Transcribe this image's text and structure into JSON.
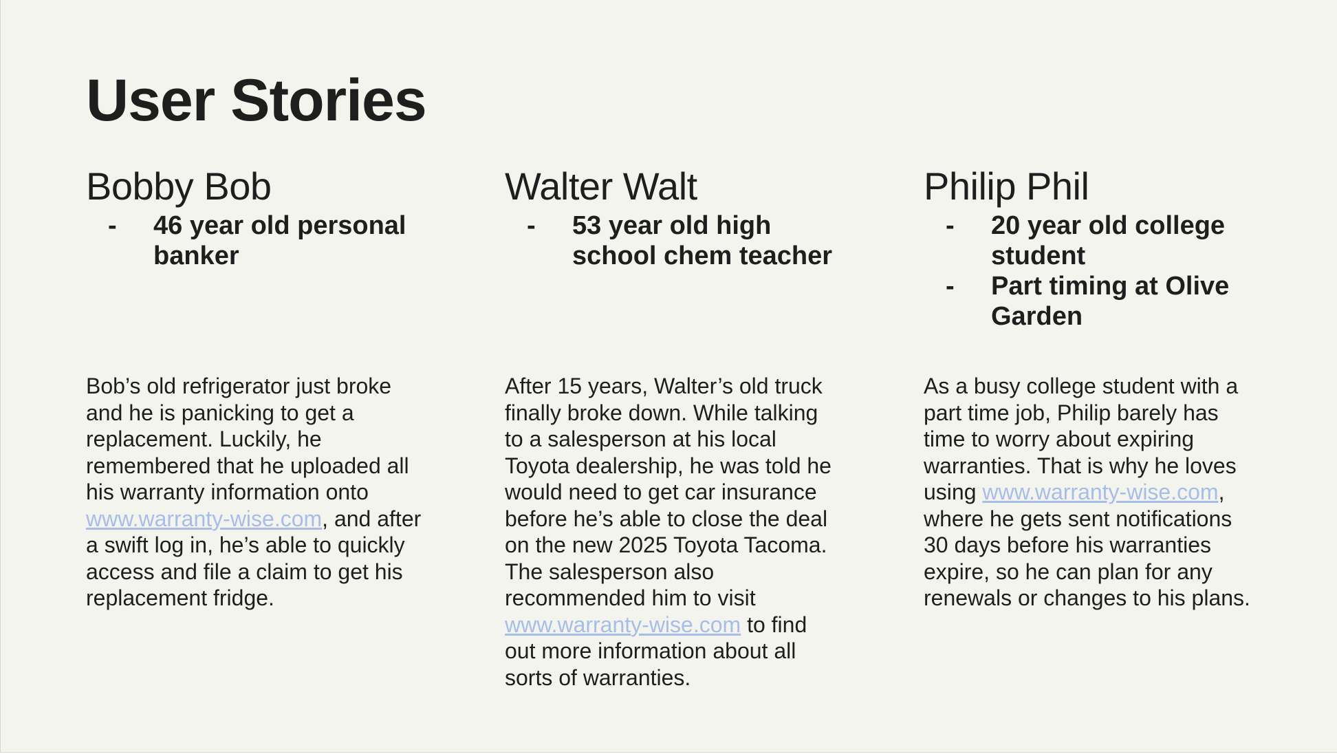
{
  "title": "User Stories",
  "personas": [
    {
      "name": "Bobby Bob",
      "traits": [
        "46 year old personal banker"
      ],
      "story": {
        "before": "Bob’s old refrigerator just broke and he is panicking to get a replacement. Luckily, he remembered that he uploaded all his warranty information onto ",
        "link": "www.warranty-wise.com",
        "after": ", and after a swift log in, he’s able to quickly access and file a claim to get his replacement fridge."
      }
    },
    {
      "name": "Walter Walt",
      "traits": [
        "53 year old high school chem teacher"
      ],
      "story": {
        "before": "After 15 years, Walter’s old truck finally broke down. While talking to a salesperson at his local Toyota dealership, he was told he would need to get car insurance before he’s able to close the deal on the new 2025 Toyota Tacoma. The salesperson also recommended him to visit ",
        "link": "www.warranty-wise.com",
        "after": " to find out more information about all sorts of warranties."
      }
    },
    {
      "name": "Philip Phil",
      "traits": [
        "20 year old college student",
        "Part timing at Olive Garden"
      ],
      "story": {
        "before": "As a busy college student with a part time job, Philip barely has time to worry about expiring warranties. That is why he loves using ",
        "link": "www.warranty-wise.com",
        "after": ", where he gets sent notifications 30 days before his warranties expire, so he can plan for any renewals or changes to his plans."
      }
    }
  ],
  "bullet_marker": "-",
  "colors": {
    "background": "#f4f4ee",
    "text": "#1e1e1e",
    "link": "#a7bde9"
  }
}
